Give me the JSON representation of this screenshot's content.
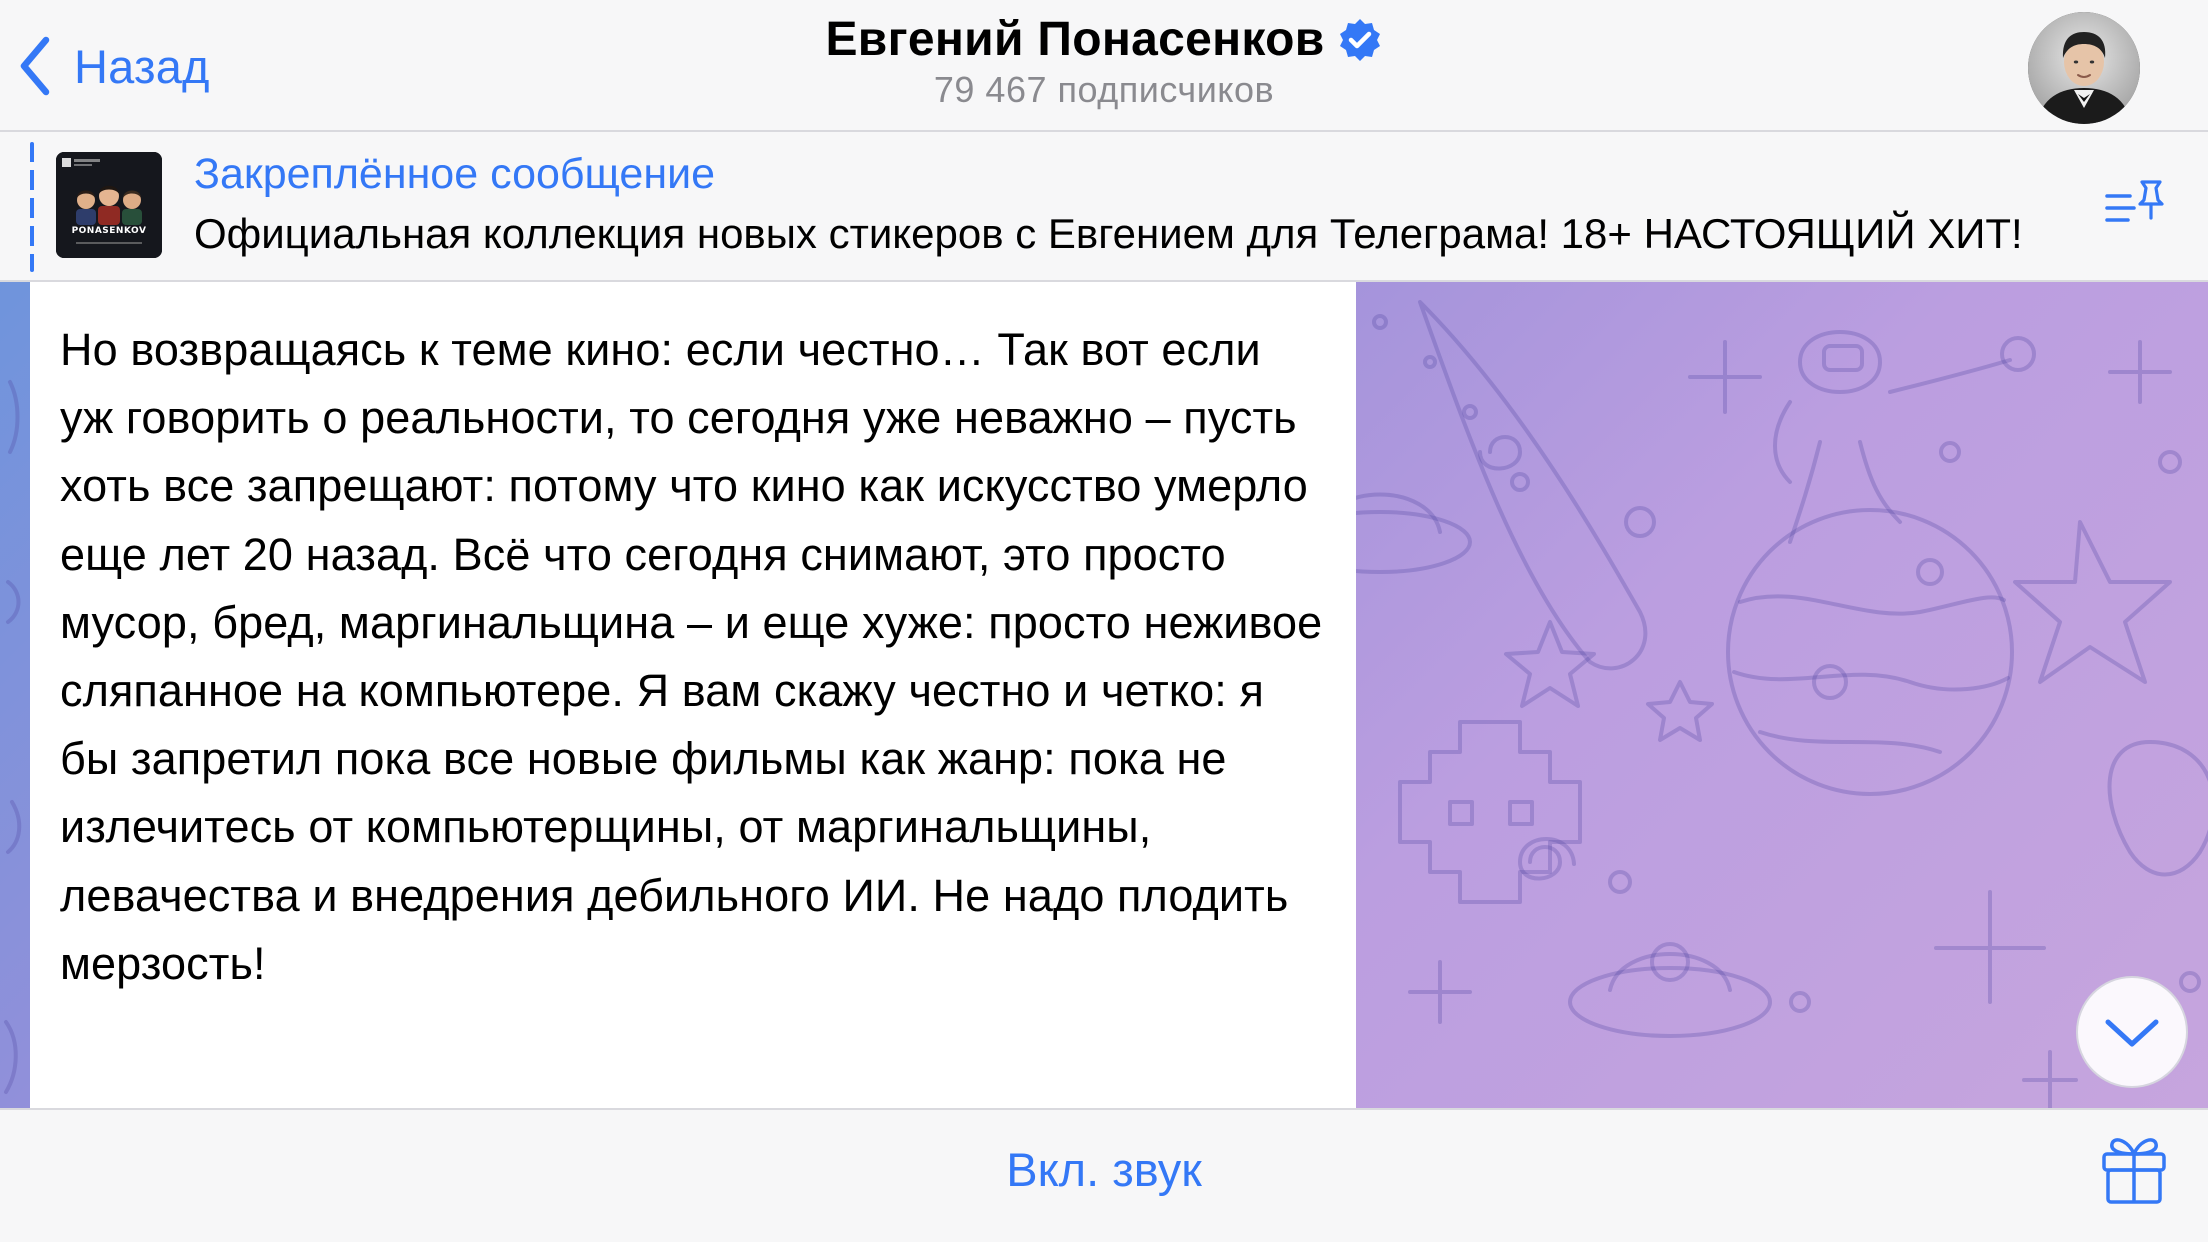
{
  "header": {
    "back_label": "Назад",
    "channel_name": "Евгений Понасенков",
    "verified_icon": "verified-badge-icon",
    "subscribers": "79 467 подписчиков",
    "avatar_icon": "channel-avatar"
  },
  "pinned": {
    "title": "Закреплённое сообщение",
    "text": "Официальная коллекция новых стикеров с Евгением для Телеграма! 18+ НАСТОЯЩИЙ ХИТ!",
    "thumbnail_label": "PONASENKOV",
    "list_icon": "pinned-list-icon"
  },
  "message": {
    "text": "Но возвращаясь к теме кино: если честно… Так вот если уж говорить о реальности, то сегодня уже неважно – пусть хоть все запрещают: потому что кино как искусство умерло еще лет 20 назад. Всё что сегодня снимают, это просто мусор, бред, маргинальщина – и еще хуже: просто неживое сляпанное на компьютере. Я вам скажу честно и четко: я бы запретил пока все новые фильмы как жанр: пока не излечитесь от компьютерщины, от маргинальщины, левачества и внедрения дебильного ИИ. Не надо плодить мерзость!"
  },
  "bottom": {
    "unmute_label": "Вкл. звук",
    "gift_icon": "gift-icon"
  },
  "colors": {
    "accent": "#3478f6",
    "bar_background": "#f7f7f8",
    "chat_gradient_start": "#6f94dc",
    "chat_gradient_end": "#c6a5de"
  }
}
